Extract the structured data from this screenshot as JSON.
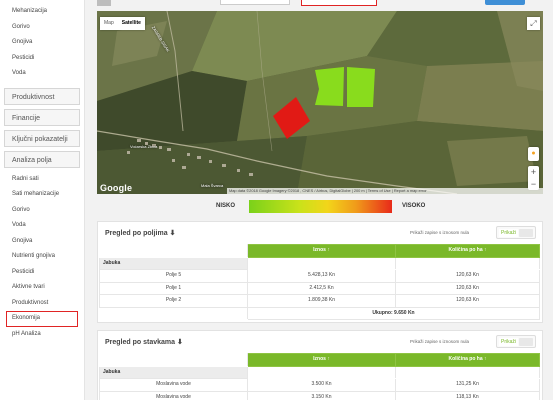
{
  "sidebar": {
    "top_items": [
      "Mehanizacija",
      "Gorivo",
      "Gnojiva",
      "Pesticidi",
      "Voda"
    ],
    "sections": [
      "Produktivnost",
      "Financije",
      "Ključni pokazatelji",
      "Analiza polja"
    ],
    "sub_items": [
      "Radni sati",
      "Sati mehanizacije",
      "Gorivo",
      "Voda",
      "Gnojiva",
      "Nutrienti gnojiva",
      "Pesticidi",
      "Aktivne tvari",
      "Produktivnost",
      "Ekonomija",
      "pH Analiza"
    ],
    "active_item": "Ekonomija"
  },
  "map": {
    "type_map": "Map",
    "type_satellite": "Satellite",
    "google": "Google",
    "attribution": "Map data ©2018 Google Imagery ©2018 , CNES / Airbus, DigitalGlobe | 200 m | Terms of Use | Report a map error",
    "place_label": "Voćarska Zbica",
    "road_label": "ZAGREB-SISAK",
    "town_label": "Mala Švarca",
    "field_colors": {
      "green1": "#8de81a",
      "green2": "#8de81a",
      "red": "#ee1111"
    }
  },
  "legend": {
    "low": "NISKO",
    "high": "VISOKO"
  },
  "panel1": {
    "title": "Pregled po poljima ⬇",
    "hint": "Prikaži zapise s iznosom nula",
    "toggle": "Prikaži",
    "col_amount": "Iznos ↑",
    "col_qty": "Količina po ha ↑",
    "group": "Jabuka",
    "rows": [
      {
        "name": "Polje 5",
        "amount": "5.428,13 Kn",
        "qty": "120,63 Kn"
      },
      {
        "name": "Polje 1",
        "amount": "2.412,5 Kn",
        "qty": "120,63 Kn"
      },
      {
        "name": "Polje 2",
        "amount": "1.809,38 Kn",
        "qty": "120,63 Kn"
      }
    ],
    "total": "Ukupno: 9.650 Kn"
  },
  "panel2": {
    "title": "Pregled po stavkama ⬇",
    "hint": "Prikaži zapise s iznosom nula",
    "toggle": "Prikaži",
    "col_amount": "Iznos ↑",
    "col_qty": "Količina po ha ↑",
    "group": "Jabuka",
    "rows": [
      {
        "name": "Moslavina vode",
        "amount": "3.500 Kn",
        "qty": "131,25 Kn"
      },
      {
        "name": "Moslavina vode",
        "amount": "3.150 Kn",
        "qty": "118,13 Kn"
      }
    ]
  }
}
